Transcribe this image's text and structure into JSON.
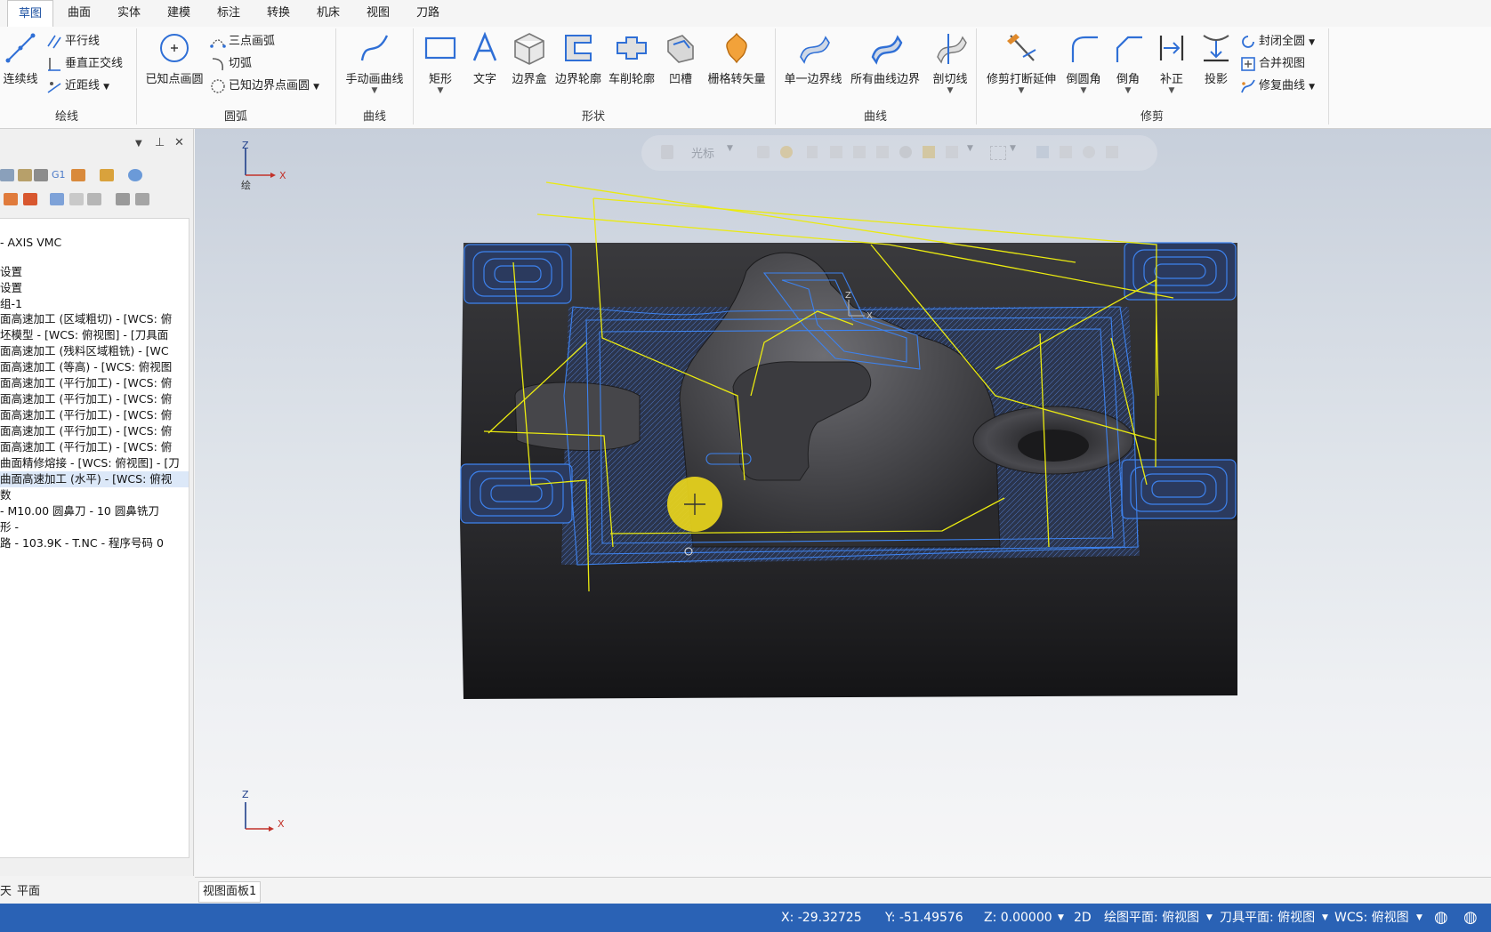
{
  "tabs": [
    "草图",
    "曲面",
    "实体",
    "建模",
    "标注",
    "转换",
    "机床",
    "视图",
    "刀路"
  ],
  "ribbon": {
    "draw_lines": {
      "group": "绘线",
      "continuous": "连续线",
      "parallel": "平行线",
      "perpendicular": "垂直正交线",
      "closest": "近距线"
    },
    "arcs": {
      "group": "圆弧",
      "circle_center": "已知点画圆",
      "three_point": "三点画弧",
      "tangent": "切弧",
      "edge_point": "已知边界点画圆"
    },
    "curves": {
      "group": "曲线",
      "manual": "手动画曲线"
    },
    "shapes": {
      "group": "形状",
      "rectangle": "矩形",
      "text": "文字",
      "bounding_box": "边界盒",
      "boundary_profile": "边界轮廓",
      "turn_profile": "车削轮廓",
      "groove": "凹槽",
      "grid_vector": "栅格转矢量"
    },
    "curves2": {
      "group": "曲线",
      "single_edge": "单一边界线",
      "all_edges": "所有曲线边界",
      "section": "剖切线"
    },
    "trim": {
      "group": "修剪",
      "trim_break": "修剪打断延伸",
      "fillet": "倒圆角",
      "chamfer": "倒角",
      "offset": "补正",
      "project": "投影",
      "close_arc": "封闭全圆",
      "join": "合并视图",
      "repair": "修复曲线"
    }
  },
  "tree": [
    "- AXIS VMC",
    "设置",
    "设置",
    "组-1",
    "面高速加工 (区域粗切) - [WCS: 俯",
    "坯模型 - [WCS: 俯视图] - [刀具面",
    "面高速加工 (残料区域粗铣) - [WC",
    "面高速加工 (等高) - [WCS: 俯视图",
    "面高速加工 (平行加工) - [WCS: 俯",
    "面高速加工 (平行加工) - [WCS: 俯",
    "面高速加工 (平行加工) - [WCS: 俯",
    "面高速加工 (平行加工) - [WCS: 俯",
    "面高速加工 (平行加工) - [WCS: 俯",
    "曲面精修熔接 - [WCS: 俯视图] - [刀",
    "曲面高速加工 (水平) - [WCS: 俯视",
    "数",
    "- M10.00 圆鼻刀 - 10 圆鼻铣刀",
    "形 -",
    "路 - 103.9K - T.NC - 程序号码 0"
  ],
  "left_tabs": [
    "天",
    "平面"
  ],
  "viewport": {
    "axis_top": {
      "z": "Z",
      "x": "X",
      "label": "绘"
    },
    "axis_bottom": {
      "z": "Z",
      "x": "X"
    },
    "floating_toolbar_label": "光标",
    "part_axis": {
      "z": "Z",
      "x": "X"
    }
  },
  "view_tab": "视图面板1",
  "status": {
    "x": "X:  -29.32725",
    "y": "Y:  -51.49576",
    "z": "Z:  0.00000",
    "mode": "2D",
    "draw_plane": "绘图平面: 俯视图",
    "tool_plane": "刀具平面: 俯视图",
    "wcs": "WCS: 俯视图"
  },
  "colors": {
    "accent": "#1a4fa0",
    "statusbar": "#2a62b5",
    "toolpath_blue": "#2f7cf0",
    "toolpath_yellow": "#f0f000",
    "highlight": "#e9d51c"
  }
}
